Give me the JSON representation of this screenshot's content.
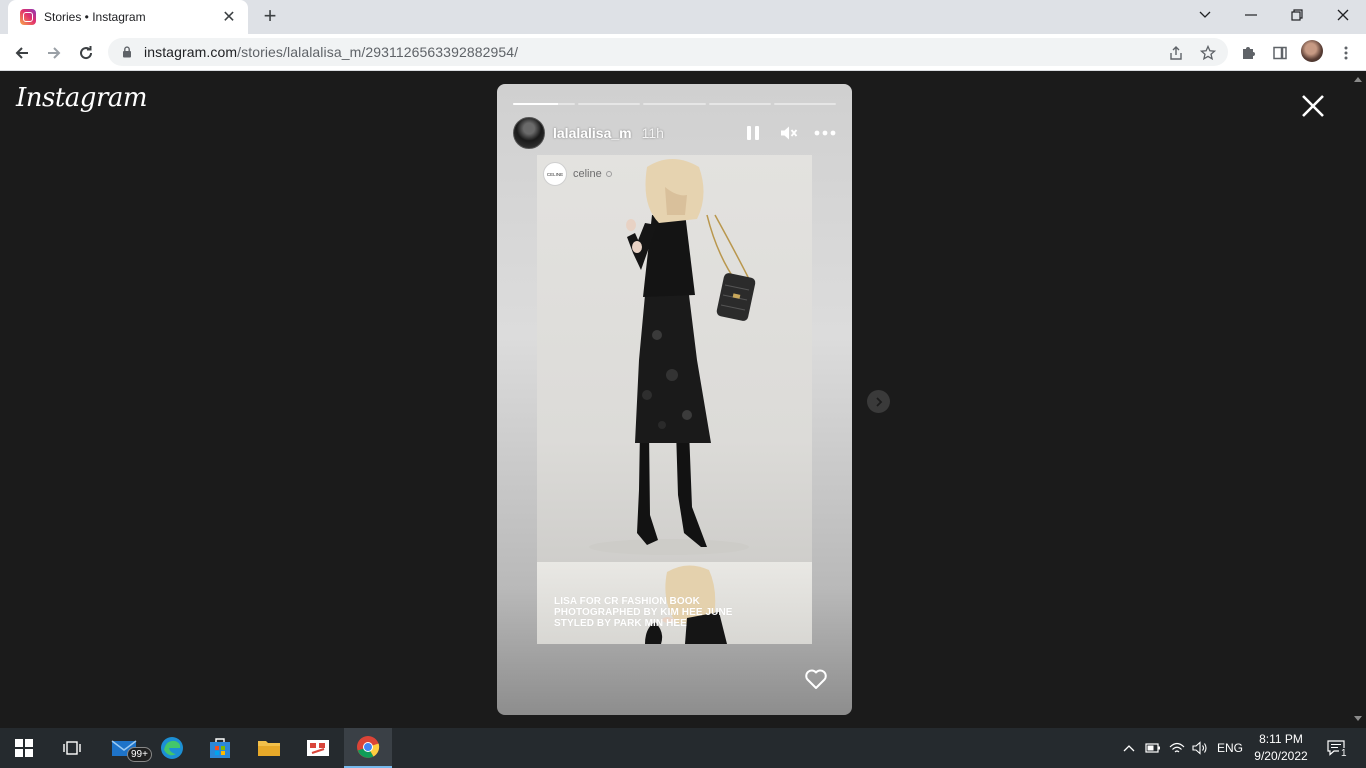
{
  "browser": {
    "tab_title": "Stories • Instagram",
    "url_host": "instagram.com",
    "url_path": "/stories/lalalalisa_m/2931126563392882954/"
  },
  "page": {
    "logo": "Instagram"
  },
  "story": {
    "username": "lalalalisa_m",
    "time_ago": "11h",
    "segments": 5,
    "progress": [
      0.72,
      0,
      0,
      0,
      0
    ],
    "shared_post": {
      "account": "celine",
      "avatar_text": "CELINE",
      "caption_lines": [
        "LISA FOR CR FASHION BOOK",
        "PHOTOGRAPHED BY KIM HEE JUNE",
        "STYLED BY PARK MIN HEE"
      ]
    }
  },
  "taskbar": {
    "mail_badge": "99+",
    "language": "ENG",
    "time": "8:11 PM",
    "date": "9/20/2022",
    "notification_count": "1"
  }
}
